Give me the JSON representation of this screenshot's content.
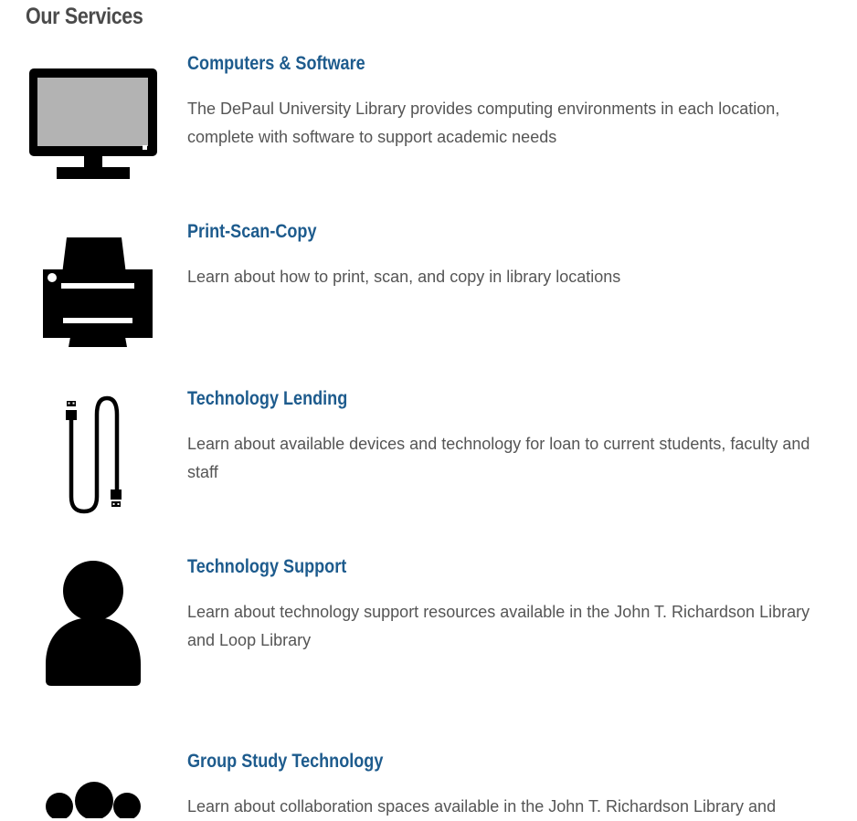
{
  "page": {
    "title": "Our Services"
  },
  "services": [
    {
      "title": "Computers & Software",
      "description": "The DePaul University Library provides computing environments in each location, complete with software to support academic needs",
      "icon": "computer-monitor-icon"
    },
    {
      "title": "Print-Scan-Copy",
      "description": "Learn about how to print, scan, and copy in library locations",
      "icon": "printer-icon"
    },
    {
      "title": "Technology Lending",
      "description": "Learn about available devices and technology for loan to current students, faculty and staff",
      "icon": "usb-cable-icon"
    },
    {
      "title": "Technology Support",
      "description": "Learn about technology support resources available in the John T. Richardson Library and Loop Library",
      "icon": "person-icon"
    },
    {
      "title": "Group Study Technology",
      "description": "Learn about collaboration spaces available in the John T. Richardson Library and",
      "icon": "group-icon"
    }
  ],
  "colors": {
    "link": "#1d5b8d",
    "heading": "#4a4a4a",
    "text": "#555555",
    "icon": "#000000",
    "screen": "#b3b3b3"
  }
}
